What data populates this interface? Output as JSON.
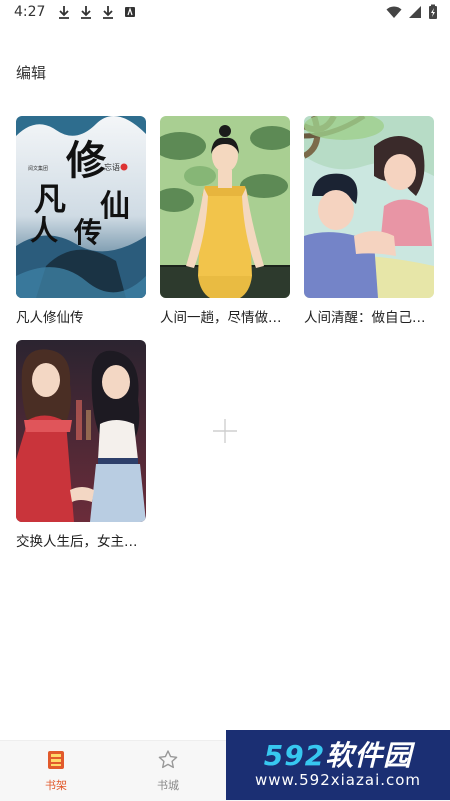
{
  "status_bar": {
    "time": "4:27"
  },
  "header": {
    "edit_label": "编辑"
  },
  "books": [
    {
      "title": "凡人修仙传"
    },
    {
      "title": "人间一趟，尽情做自己"
    },
    {
      "title": "人间清醒：做自己的…"
    },
    {
      "title": "交换人生后，女主满…"
    }
  ],
  "cover1_text": {
    "title_chars": "凡人修仙传",
    "author": "忘语",
    "publisher": "阅文集团"
  },
  "add_slot": {
    "icon": "plus-icon"
  },
  "tabbar": {
    "items": [
      {
        "label": "书架",
        "icon": "bookshelf-icon",
        "active": true
      },
      {
        "label": "书城",
        "icon": "star-icon",
        "active": false
      }
    ],
    "active_color": "#e25a2c"
  },
  "watermark": {
    "main_num": "592",
    "main_text": "软件园",
    "url": "www.592xiazai.com"
  }
}
